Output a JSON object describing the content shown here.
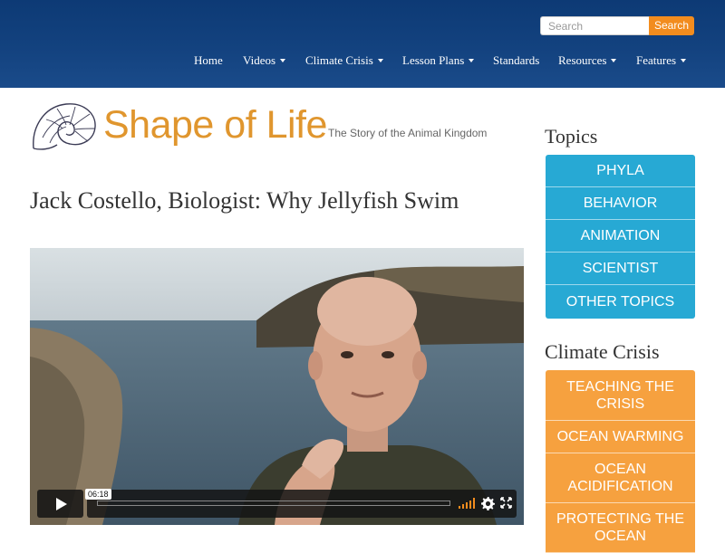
{
  "search": {
    "placeholder": "Search",
    "button_label": "Search"
  },
  "nav": [
    {
      "label": "Home",
      "dropdown": false
    },
    {
      "label": "Videos",
      "dropdown": true
    },
    {
      "label": "Climate Crisis",
      "dropdown": true
    },
    {
      "label": "Lesson Plans",
      "dropdown": true
    },
    {
      "label": "Standards",
      "dropdown": false
    },
    {
      "label": "Resources",
      "dropdown": true
    },
    {
      "label": "Features",
      "dropdown": true
    }
  ],
  "logo": {
    "name": "Shape of Life",
    "tagline": "The Story of the Animal Kingdom",
    "icon": "nautilus-shell-icon"
  },
  "page_title": "Jack Costello, Biologist: Why Jellyfish Swim",
  "video": {
    "time_label": "06:18",
    "icons": [
      "play-icon",
      "volume-icon",
      "gear-icon",
      "fullscreen-icon"
    ]
  },
  "sidebar": {
    "topics_heading": "Topics",
    "topics": [
      "PHYLA",
      "BEHAVIOR",
      "ANIMATION",
      "SCIENTIST",
      "OTHER TOPICS"
    ],
    "climate_heading": "Climate Crisis",
    "climate": [
      "TEACHING THE CRISIS",
      "OCEAN WARMING",
      "OCEAN ACIDIFICATION",
      "PROTECTING THE OCEAN"
    ]
  },
  "colors": {
    "header": "#13427f",
    "accent_orange": "#f28c1e",
    "topic_blue": "#27a9d4",
    "climate_orange": "#f6a13f",
    "logo_orange": "#e0962e"
  }
}
